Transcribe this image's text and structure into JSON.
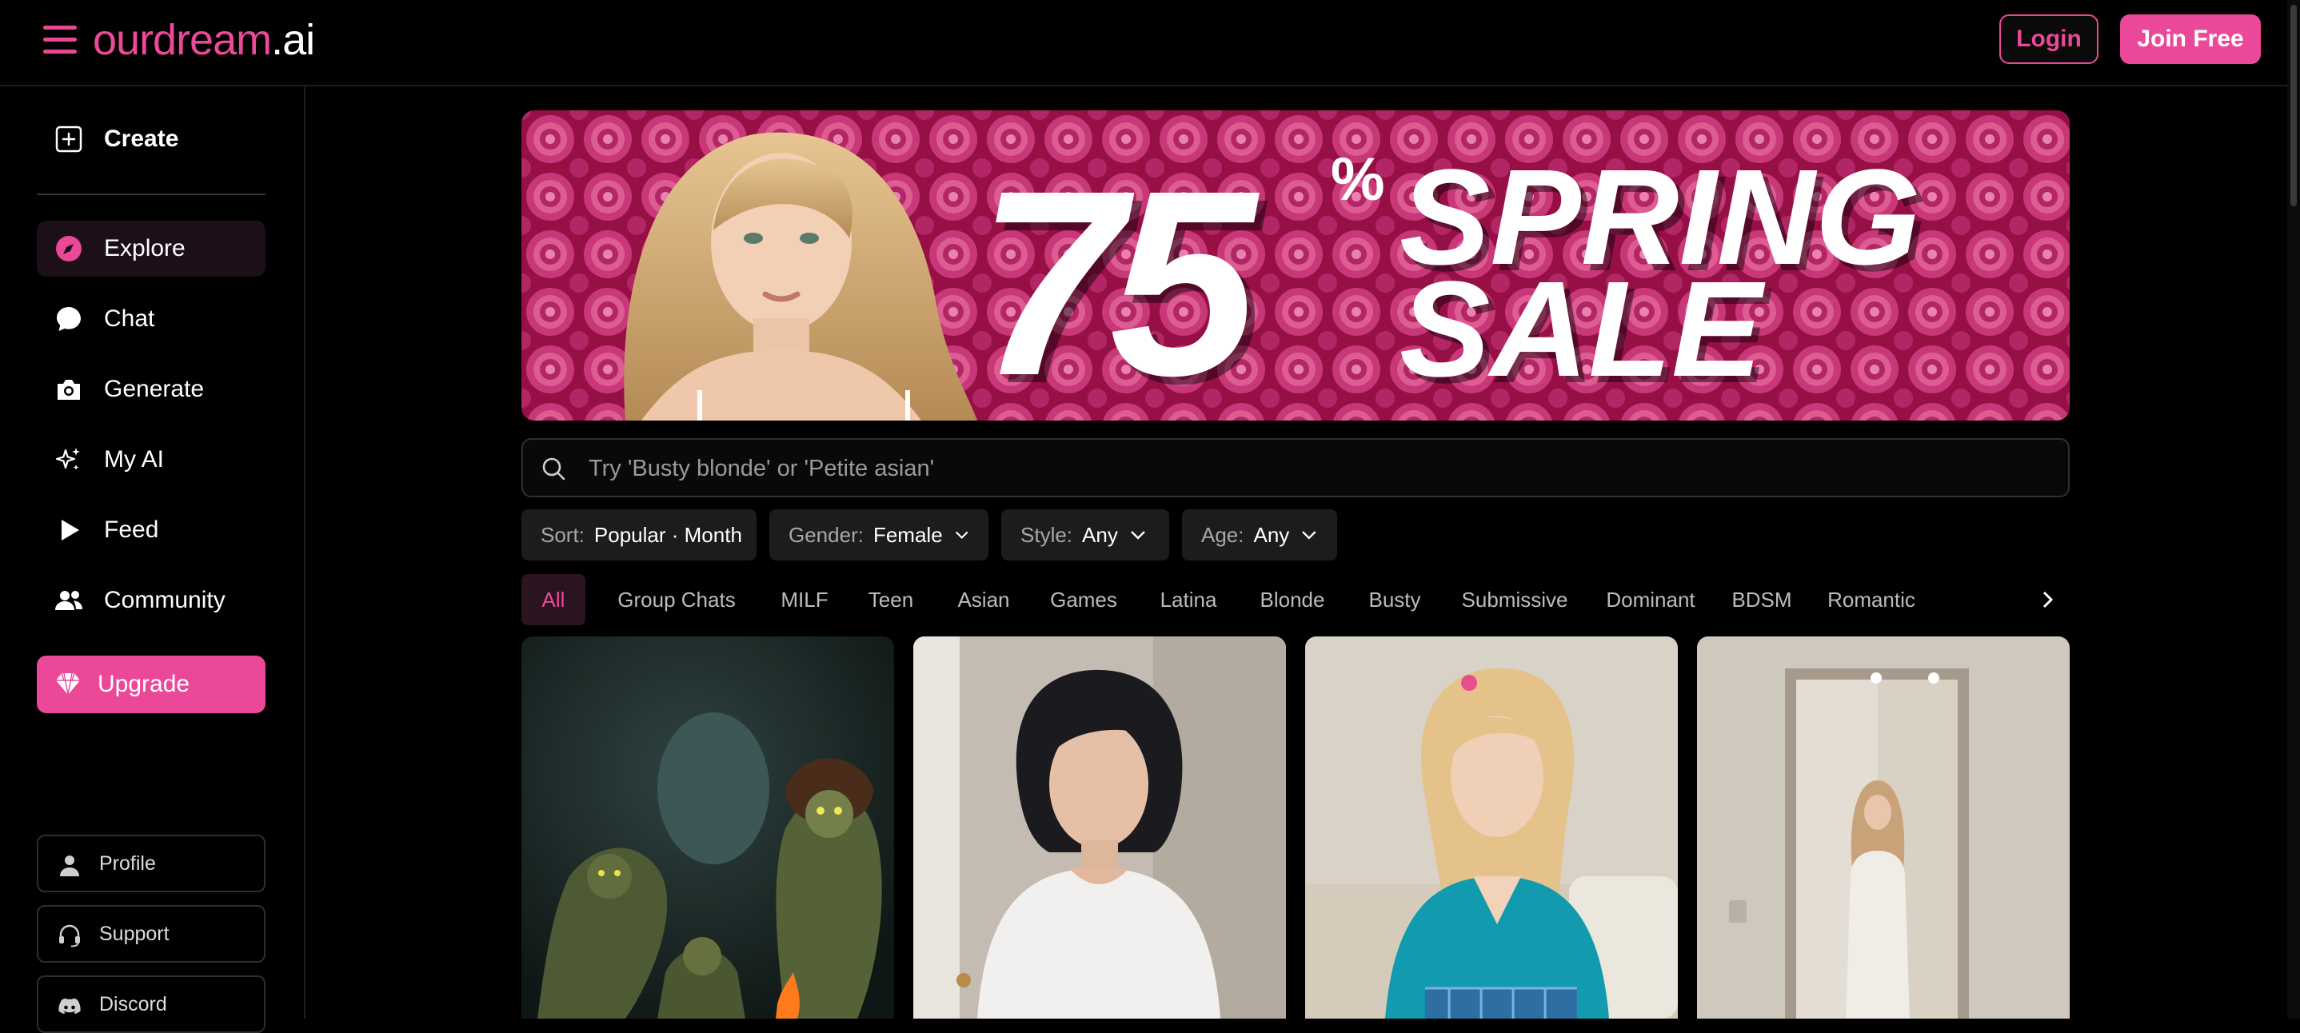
{
  "header": {
    "logo_brand": "ourdream",
    "logo_tld": ".ai",
    "login_label": "Login",
    "join_label": "Join Free"
  },
  "sidebar": {
    "create_label": "Create",
    "items": [
      {
        "label": "Explore",
        "icon": "compass-icon",
        "active": true
      },
      {
        "label": "Chat",
        "icon": "chat-bubble-icon"
      },
      {
        "label": "Generate",
        "icon": "camera-icon"
      },
      {
        "label": "My AI",
        "icon": "sparkles-icon"
      },
      {
        "label": "Feed",
        "icon": "play-icon"
      },
      {
        "label": "Community",
        "icon": "users-icon"
      }
    ],
    "upgrade_label": "Upgrade",
    "bottom": [
      {
        "label": "Profile",
        "icon": "user-icon"
      },
      {
        "label": "Support",
        "icon": "headset-icon"
      },
      {
        "label": "Discord",
        "icon": "discord-icon"
      }
    ]
  },
  "banner": {
    "percent": "75",
    "percent_sign": "%",
    "line1": "SPRING",
    "line2": "SALE"
  },
  "search": {
    "placeholder": "Try 'Busty blonde' or 'Petite asian'"
  },
  "filters": {
    "sort_key": "Sort:",
    "sort_value": "Popular · Month",
    "gender_key": "Gender:",
    "gender_value": "Female",
    "style_key": "Style:",
    "style_value": "Any",
    "age_key": "Age:",
    "age_value": "Any"
  },
  "tags": [
    "All",
    "Group Chats",
    "MILF",
    "Teen",
    "Asian",
    "Games",
    "Latina",
    "Blonde",
    "Busty",
    "Submissive",
    "Dominant",
    "BDSM",
    "Romantic"
  ],
  "colors": {
    "accent": "#ec4899",
    "background": "#000000",
    "chip_bg": "#1c1c1c",
    "active_nav_bg": "#1d0f17"
  }
}
